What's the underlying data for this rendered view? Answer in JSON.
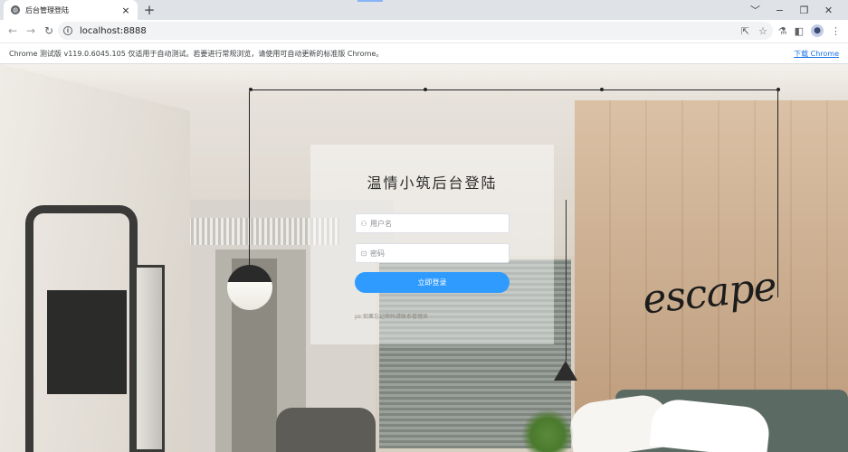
{
  "browser": {
    "tab_title": "后台管理登陆",
    "tab_close": "×",
    "new_tab": "+",
    "url": "localhost:8888",
    "window_controls": [
      "﹀",
      "−",
      "❐",
      "✕"
    ]
  },
  "infobar": {
    "message": "Chrome 测试版 v119.0.6045.105 仅适用于自动测试。若要进行常规浏览，请使用可自动更新的标准版 Chrome。",
    "download_link": "下载 Chrome"
  },
  "scene": {
    "wall_text": "escape"
  },
  "login": {
    "title": "温情小筑后台登陆",
    "username_placeholder": "用户名",
    "password_placeholder": "密码",
    "submit_label": "立即登录",
    "hint": "ps:如果忘记密码请联系管理员"
  },
  "colors": {
    "accent": "#2f9bff",
    "link": "#1a73e8"
  },
  "icons": [
    "globe-icon",
    "back-arrow-icon",
    "forward-arrow-icon",
    "reload-icon",
    "info-icon",
    "share-icon",
    "star-icon",
    "extensions-icon",
    "side-panel-icon",
    "profile-icon",
    "menu-icon",
    "user-icon",
    "lock-icon"
  ]
}
